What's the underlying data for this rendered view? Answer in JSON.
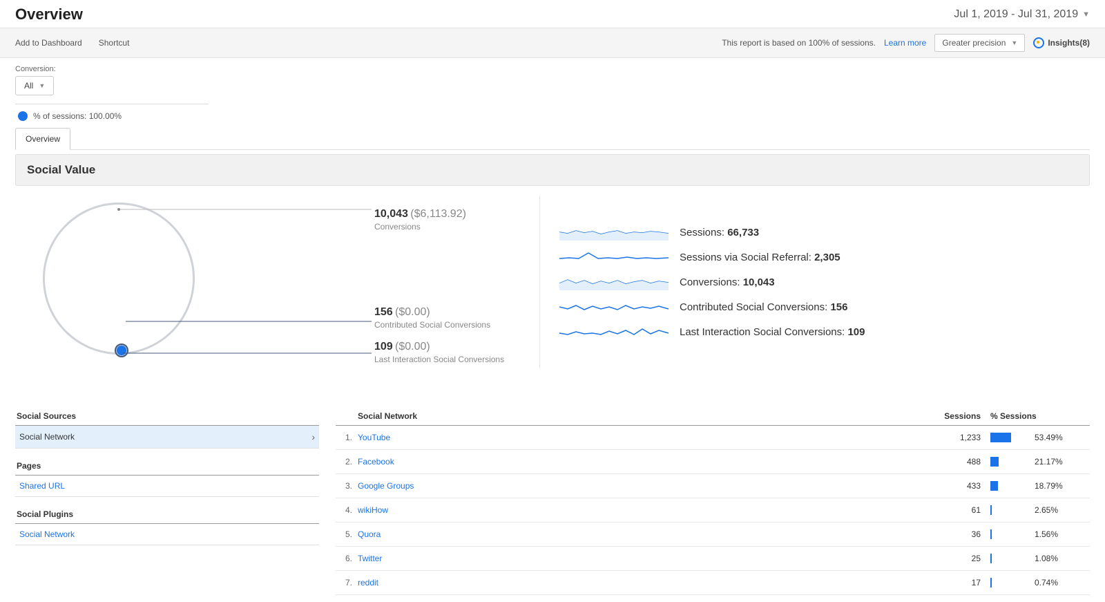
{
  "header": {
    "title": "Overview",
    "date_range": "Jul 1, 2019 - Jul 31, 2019"
  },
  "toolbar": {
    "add_to_dashboard": "Add to Dashboard",
    "shortcut": "Shortcut",
    "report_note_prefix": "This report is based on 100% of sessions.",
    "learn_more": "Learn more",
    "precision": "Greater precision",
    "insights": "Insights(8)"
  },
  "conversion": {
    "label": "Conversion:",
    "selector": "All"
  },
  "sessions_pct": "% of sessions: 100.00%",
  "tabs": {
    "overview": "Overview"
  },
  "panel": {
    "title": "Social Value"
  },
  "circle_metrics": {
    "m1": {
      "value": "10,043",
      "money": "($6,113.92)",
      "label": "Conversions"
    },
    "m2": {
      "value": "156",
      "money": "($0.00)",
      "label": "Contributed Social Conversions"
    },
    "m3": {
      "value": "109",
      "money": "($0.00)",
      "label": "Last Interaction Social Conversions"
    }
  },
  "stats": [
    {
      "label": "Sessions:",
      "value": "66,733"
    },
    {
      "label": "Sessions via Social Referral:",
      "value": "2,305"
    },
    {
      "label": "Conversions:",
      "value": "10,043"
    },
    {
      "label": "Contributed Social Conversions:",
      "value": "156"
    },
    {
      "label": "Last Interaction Social Conversions:",
      "value": "109"
    }
  ],
  "social_sources": {
    "header": "Social Sources",
    "selected": "Social Network"
  },
  "pages": {
    "header": "Pages",
    "link": "Shared URL"
  },
  "plugins": {
    "header": "Social Plugins",
    "link": "Social Network"
  },
  "table": {
    "col_network": "Social Network",
    "col_sessions": "Sessions",
    "col_pct": "% Sessions",
    "rows": [
      {
        "idx": "1.",
        "name": "YouTube",
        "sessions": "1,233",
        "pct": "53.49%",
        "bar": 53.49
      },
      {
        "idx": "2.",
        "name": "Facebook",
        "sessions": "488",
        "pct": "21.17%",
        "bar": 21.17
      },
      {
        "idx": "3.",
        "name": "Google Groups",
        "sessions": "433",
        "pct": "18.79%",
        "bar": 18.79
      },
      {
        "idx": "4.",
        "name": "wikiHow",
        "sessions": "61",
        "pct": "2.65%",
        "bar": 2.65
      },
      {
        "idx": "5.",
        "name": "Quora",
        "sessions": "36",
        "pct": "1.56%",
        "bar": 1.56
      },
      {
        "idx": "6.",
        "name": "Twitter",
        "sessions": "25",
        "pct": "1.08%",
        "bar": 1.08
      },
      {
        "idx": "7.",
        "name": "reddit",
        "sessions": "17",
        "pct": "0.74%",
        "bar": 0.74
      }
    ]
  },
  "chart_data": {
    "type": "table",
    "title": "Social Network – Sessions",
    "categories": [
      "YouTube",
      "Facebook",
      "Google Groups",
      "wikiHow",
      "Quora",
      "Twitter",
      "reddit"
    ],
    "values": [
      1233,
      488,
      433,
      61,
      36,
      25,
      17
    ],
    "percent_sessions": [
      53.49,
      21.17,
      18.79,
      2.65,
      1.56,
      1.08,
      0.74
    ]
  }
}
